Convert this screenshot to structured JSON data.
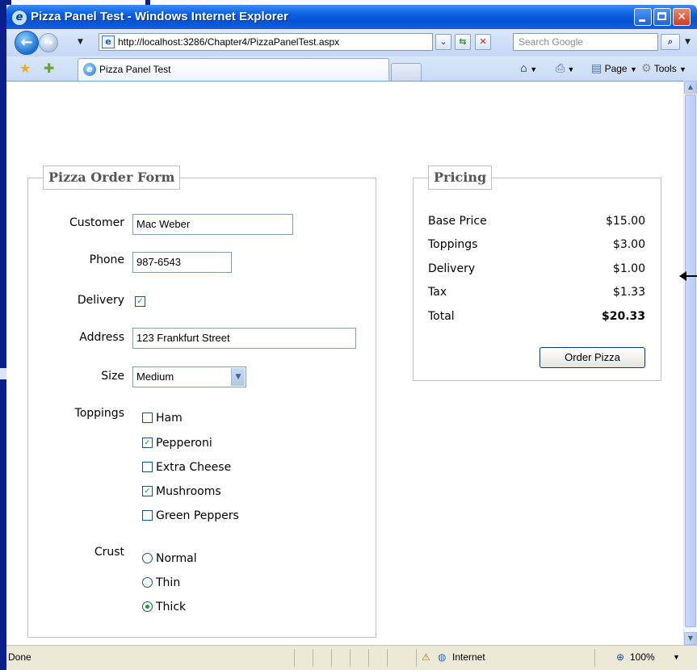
{
  "window": {
    "title": "Pizza Panel Test - Windows Internet Explorer"
  },
  "navbar": {
    "url": "http://localhost:3286/Chapter4/PizzaPanelTest.aspx",
    "search_placeholder": "Search Google"
  },
  "tabbar": {
    "tab_title": "Pizza Panel Test",
    "page_label": "Page",
    "tools_label": "Tools"
  },
  "order_form": {
    "legend": "Pizza Order Form",
    "customer_label": "Customer",
    "customer_value": "Mac Weber",
    "phone_label": "Phone",
    "phone_value": "987-6543",
    "delivery_label": "Delivery",
    "delivery_checked": true,
    "address_label": "Address",
    "address_value": "123 Frankfurt Street",
    "size_label": "Size",
    "size_value": "Medium",
    "toppings_label": "Toppings",
    "toppings": [
      {
        "label": "Ham",
        "checked": false
      },
      {
        "label": "Pepperoni",
        "checked": true
      },
      {
        "label": "Extra Cheese",
        "checked": false
      },
      {
        "label": "Mushrooms",
        "checked": true
      },
      {
        "label": "Green Peppers",
        "checked": false
      }
    ],
    "crust_label": "Crust",
    "crusts": [
      {
        "label": "Normal",
        "selected": false
      },
      {
        "label": "Thin",
        "selected": false
      },
      {
        "label": "Thick",
        "selected": true
      }
    ]
  },
  "pricing": {
    "legend": "Pricing",
    "rows": [
      {
        "label": "Base Price",
        "value": "$15.00"
      },
      {
        "label": "Toppings",
        "value": "$3.00"
      },
      {
        "label": "Delivery",
        "value": "$1.00"
      },
      {
        "label": "Tax",
        "value": "$1.33"
      },
      {
        "label": "Total",
        "value": "$20.33"
      }
    ],
    "order_button": "Order Pizza"
  },
  "status": {
    "text": "Done",
    "zone": "Internet",
    "zoom": "100%"
  }
}
